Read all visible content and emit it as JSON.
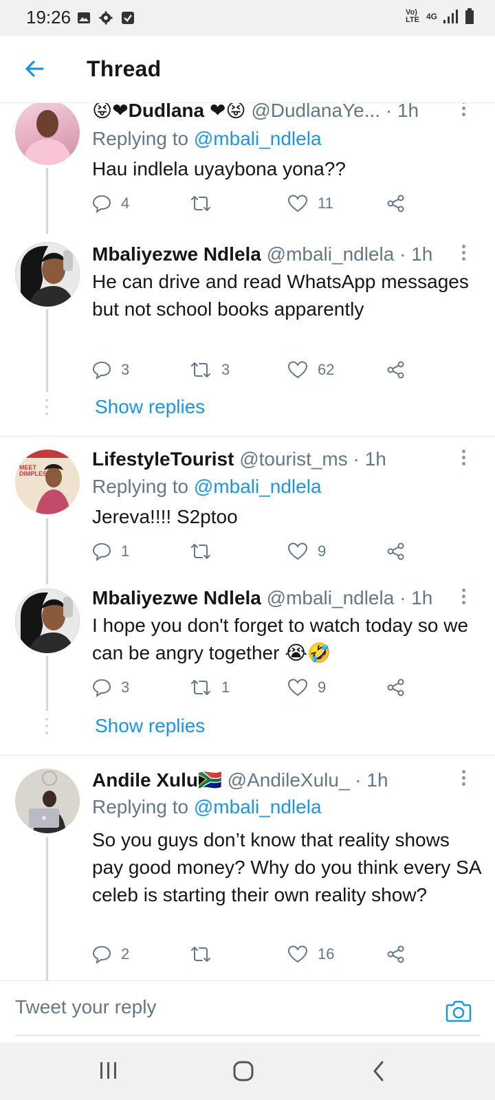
{
  "status_bar": {
    "time": "19:26",
    "network": "4G",
    "volte": "Vo) LTE"
  },
  "header": {
    "title": "Thread"
  },
  "tweets": [
    {
      "name": "😝❤Dudlana ❤😝",
      "handle": "@DudlanaYe... · 1h",
      "replying_prefix": "Replying to",
      "replying_to": "@mbali_ndlela",
      "text": "Hau indlela uyaybona yona??",
      "replies": "4",
      "retweets": "",
      "likes": "11"
    },
    {
      "name": "Mbaliyezwe Ndlela",
      "handle": "@mbali_ndlela · 1h",
      "text": "He can drive and read WhatsApp messages but not school books apparently",
      "replies": "3",
      "retweets": "3",
      "likes": "62",
      "show_replies": "Show replies"
    },
    {
      "name": "LifestyleTourist",
      "handle": "@tourist_ms · 1h",
      "replying_prefix": "Replying to",
      "replying_to": "@mbali_ndlela",
      "text": "Jereva!!!! S2ptoo",
      "replies": "1",
      "retweets": "",
      "likes": "9",
      "avatar_text": "MEET DIMPLES"
    },
    {
      "name": "Mbaliyezwe Ndlela",
      "handle": "@mbali_ndlela · 1h",
      "text": "I hope you don't forget to watch today so we can be angry together 😭🤣",
      "replies": "3",
      "retweets": "1",
      "likes": "9",
      "show_replies": "Show replies"
    },
    {
      "name": "Andile Xulu🇿🇦",
      "handle": "@AndileXulu_ · 1h",
      "replying_prefix": "Replying to",
      "replying_to": "@mbali_ndlela",
      "text": "So you guys don’t know that reality shows pay good money? Why do you think every SA celeb is starting their own reality show?",
      "replies": "2",
      "retweets": "",
      "likes": "16"
    }
  ],
  "reply_bar": {
    "placeholder": "Tweet your reply"
  },
  "icons": {
    "back": "arrow-left-icon",
    "reply": "comment-icon",
    "retweet": "retweet-icon",
    "like": "heart-icon",
    "share": "share-icon",
    "camera": "camera-icon"
  },
  "colors": {
    "accent": "#1b95e0",
    "secondary_text": "#657786",
    "thread_line": "#cfd9de"
  }
}
